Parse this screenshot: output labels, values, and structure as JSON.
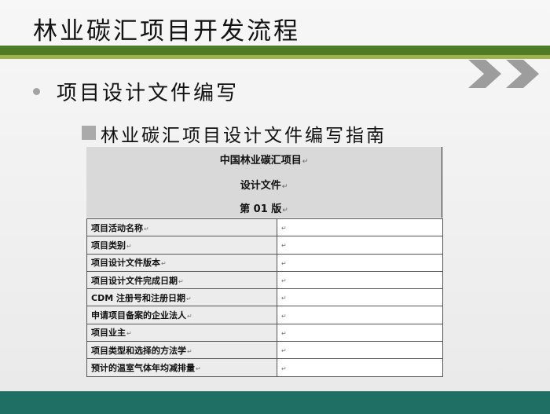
{
  "slide": {
    "title": "林业碳汇项目开发流程",
    "bullet1": "项目设计文件编写",
    "bullet2": "林业碳汇项目设计文件编写指南"
  },
  "document": {
    "header_lines": [
      "中国林业碳汇项目",
      "设计文件",
      "第 01 版"
    ],
    "paragraph_mark": "↵",
    "rows": [
      {
        "label": "项目活动名称",
        "value": ""
      },
      {
        "label": "项目类别",
        "value": ""
      },
      {
        "label": "项目设计文件版本",
        "value": ""
      },
      {
        "label": "项目设计文件完成日期",
        "value": ""
      },
      {
        "label": "CDM 注册号和注册日期",
        "value": ""
      },
      {
        "label": "申请项目备案的企业法人",
        "value": ""
      },
      {
        "label": "项目业主",
        "value": ""
      },
      {
        "label": "项目类型和选择的方法学",
        "value": ""
      },
      {
        "label": "预计的温室气体年均减排量",
        "value": ""
      }
    ]
  },
  "colors": {
    "title_bar": "#4f7a26",
    "accent_bar": "#a0b24e",
    "footer": "#1f6f64",
    "chevron": "#9d9d9d"
  }
}
